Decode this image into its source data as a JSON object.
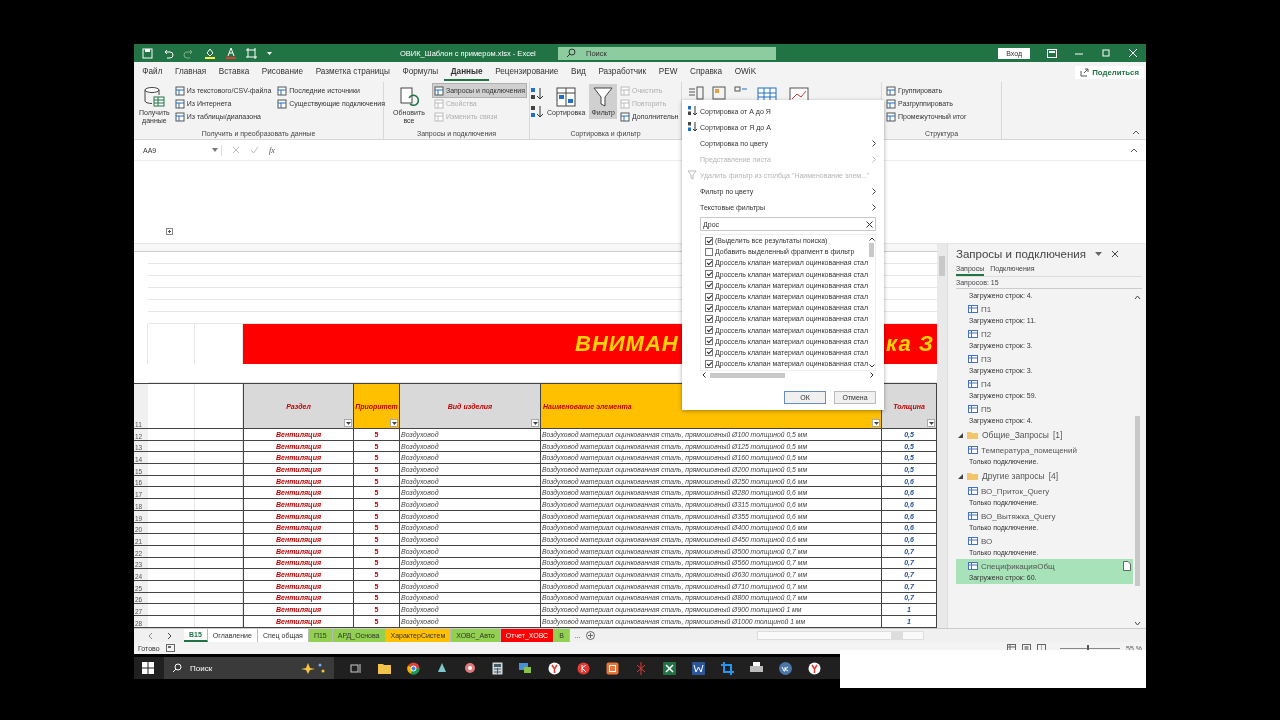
{
  "window": {
    "title": "ОВИК_Шаблон с примером.xlsx  -  Excel",
    "search_placeholder": "Поиск",
    "sign_in": "Вход"
  },
  "menu_tabs": [
    {
      "label": "Файл",
      "selected": false
    },
    {
      "label": "Главная",
      "selected": false
    },
    {
      "label": "Вставка",
      "selected": false
    },
    {
      "label": "Рисование",
      "selected": false
    },
    {
      "label": "Разметка страницы",
      "selected": false
    },
    {
      "label": "Формулы",
      "selected": false
    },
    {
      "label": "Данные",
      "selected": true
    },
    {
      "label": "Рецензирование",
      "selected": false
    },
    {
      "label": "Вид",
      "selected": false
    },
    {
      "label": "Разработчик",
      "selected": false
    },
    {
      "label": "PEW",
      "selected": false
    },
    {
      "label": "Справка",
      "selected": false
    },
    {
      "label": "OWiK",
      "selected": false
    }
  ],
  "share": "Поделиться",
  "ribbon_groups": [
    {
      "kind": "data",
      "title": "Получить и преобразовать данные",
      "large": [
        {
          "label": "Получить данные",
          "selected": false
        }
      ],
      "small": [
        {
          "label": "Из текстового/CSV-файла",
          "disabled": false,
          "selected": false
        },
        {
          "label": "Из Интернета",
          "disabled": false,
          "selected": false
        },
        {
          "label": "Из таблицы/диапазона",
          "disabled": false,
          "selected": false
        },
        {
          "label": "Последние источники",
          "disabled": false,
          "selected": false
        },
        {
          "label": "Существующие подключения",
          "disabled": false,
          "selected": false
        }
      ]
    },
    {
      "kind": "data",
      "title": "Запросы и подключения",
      "large": [
        {
          "label": "Обновить все",
          "selected": false
        }
      ],
      "small": [
        {
          "label": "Запросы и подключения",
          "disabled": false,
          "selected": true
        },
        {
          "label": "Свойства",
          "disabled": true,
          "selected": false
        },
        {
          "label": "Изменить связи",
          "disabled": true,
          "selected": false
        }
      ]
    },
    {
      "kind": "sort",
      "title": "Сортировка и фильтр",
      "large": [
        {
          "label": "Сортировка",
          "selected": false
        },
        {
          "label": "Фильтр",
          "selected": true
        }
      ],
      "small": [
        {
          "label": "Очистить",
          "disabled": true,
          "selected": false
        },
        {
          "label": "Повторить",
          "disabled": true,
          "selected": false
        },
        {
          "label": "Дополнительн",
          "disabled": false,
          "selected": false
        }
      ]
    },
    {
      "kind": "icons"
    },
    {
      "kind": "outline",
      "title": "Структура",
      "small": [
        {
          "label": "Группировать",
          "disabled": false,
          "selected": false
        },
        {
          "label": "Разгруппировать",
          "disabled": false,
          "selected": false
        },
        {
          "label": "Промежуточный итог",
          "disabled": false,
          "selected": false
        }
      ]
    }
  ],
  "formula_bar": {
    "name_box": "AA9",
    "function_label": "fx"
  },
  "sheet": {
    "banner": {
      "left_text": "ВНИМАН",
      "right_text": "ка З"
    },
    "header_row_number": "11",
    "columns": [
      {
        "label": "Раздел",
        "color": "#d9d9d9"
      },
      {
        "label": "Приоритет",
        "color": "#ffc000"
      },
      {
        "label": "Вид изделия",
        "color": "#d9d9d9"
      },
      {
        "label": "Наименование элемента",
        "color": "#ffc000"
      },
      {
        "label": "Толщина",
        "color": "#d9d9d9"
      }
    ],
    "rows": [
      {
        "number": "12",
        "section": "Вентиляция",
        "priority": "5",
        "type": "Воздуховод",
        "name": "Воздуховод материал оцинкованная сталь, прямошовный Ø100 толщиной 0,5 мм",
        "thickness": "0,5"
      },
      {
        "number": "13",
        "section": "Вентиляция",
        "priority": "5",
        "type": "Воздуховод",
        "name": "Воздуховод материал оцинкованная сталь, прямошовный Ø125 толщиной 0,5 мм",
        "thickness": "0,5"
      },
      {
        "number": "14",
        "section": "Вентиляция",
        "priority": "5",
        "type": "Воздуховод",
        "name": "Воздуховод материал оцинкованная сталь, прямошовный Ø160 толщиной 0,5 мм",
        "thickness": "0,5"
      },
      {
        "number": "15",
        "section": "Вентиляция",
        "priority": "5",
        "type": "Воздуховод",
        "name": "Воздуховод материал оцинкованная сталь, прямошовный Ø200 толщиной 0,5 мм",
        "thickness": "0,5"
      },
      {
        "number": "16",
        "section": "Вентиляция",
        "priority": "5",
        "type": "Воздуховод",
        "name": "Воздуховод материал оцинкованная сталь, прямошовный Ø250 толщиной 0,6 мм",
        "thickness": "0,6"
      },
      {
        "number": "17",
        "section": "Вентиляция",
        "priority": "5",
        "type": "Воздуховод",
        "name": "Воздуховод материал оцинкованная сталь, прямошовный Ø280 толщиной 0,6 мм",
        "thickness": "0,6"
      },
      {
        "number": "18",
        "section": "Вентиляция",
        "priority": "5",
        "type": "Воздуховод",
        "name": "Воздуховод материал оцинкованная сталь, прямошовный Ø315 толщиной 0,6 мм",
        "thickness": "0,6"
      },
      {
        "number": "19",
        "section": "Вентиляция",
        "priority": "5",
        "type": "Воздуховод",
        "name": "Воздуховод материал оцинкованная сталь, прямошовный Ø355 толщиной 0,6 мм",
        "thickness": "0,6"
      },
      {
        "number": "20",
        "section": "Вентиляция",
        "priority": "5",
        "type": "Воздуховод",
        "name": "Воздуховод материал оцинкованная сталь, прямошовный Ø400 толщиной 0,6 мм",
        "thickness": "0,6"
      },
      {
        "number": "21",
        "section": "Вентиляция",
        "priority": "5",
        "type": "Воздуховод",
        "name": "Воздуховод материал оцинкованная сталь, прямошовный Ø450 толщиной 0,6 мм",
        "thickness": "0,6"
      },
      {
        "number": "22",
        "section": "Вентиляция",
        "priority": "5",
        "type": "Воздуховод",
        "name": "Воздуховод материал оцинкованная сталь, прямошовный Ø500 толщиной 0,7 мм",
        "thickness": "0,7"
      },
      {
        "number": "23",
        "section": "Вентиляция",
        "priority": "5",
        "type": "Воздуховод",
        "name": "Воздуховод материал оцинкованная сталь, прямошовный Ø560 толщиной 0,7 мм",
        "thickness": "0,7"
      },
      {
        "number": "24",
        "section": "Вентиляция",
        "priority": "5",
        "type": "Воздуховод",
        "name": "Воздуховод материал оцинкованная сталь, прямошовный Ø630 толщиной 0,7 мм",
        "thickness": "0,7"
      },
      {
        "number": "25",
        "section": "Вентиляция",
        "priority": "5",
        "type": "Воздуховод",
        "name": "Воздуховод материал оцинкованная сталь, прямошовный Ø710 толщиной 0,7 мм",
        "thickness": "0,7"
      },
      {
        "number": "26",
        "section": "Вентиляция",
        "priority": "5",
        "type": "Воздуховод",
        "name": "Воздуховод материал оцинкованная сталь, прямошовный Ø800 толщиной 0,7 мм",
        "thickness": "0,7"
      },
      {
        "number": "27",
        "section": "Вентиляция",
        "priority": "5",
        "type": "Воздуховод",
        "name": "Воздуховод материал оцинкованная сталь, прямошовный Ø900 толщиной 1 мм",
        "thickness": "1"
      },
      {
        "number": "28",
        "section": "Вентиляция",
        "priority": "5",
        "type": "Воздуховод",
        "name": "Воздуховод материал оцинкованная сталь, прямошовный Ø1000 толщиной 1 мм",
        "thickness": "1"
      }
    ]
  },
  "filter_menu": {
    "items": [
      {
        "kind": "sort-asc",
        "label": "Сортировка от А до Я",
        "disabled": false
      },
      {
        "kind": "sort-desc",
        "label": "Сортировка от Я до А",
        "disabled": false
      },
      {
        "kind": "submenu",
        "label": "Сортировка по цвету",
        "disabled": false
      },
      {
        "kind": "submenu",
        "label": "Представление листа",
        "disabled": true
      },
      {
        "kind": "clear",
        "label": "Удалить фильтр из столбца \"Наименование элем...\"",
        "disabled": true
      },
      {
        "kind": "submenu",
        "label": "Фильтр по цвету",
        "disabled": false
      },
      {
        "kind": "submenu",
        "label": "Текстовые фильтры",
        "disabled": false
      }
    ],
    "search_value": "Дрос",
    "options": [
      {
        "label": "(Выделить все результаты поиска)",
        "checked": true
      },
      {
        "label": "Добавить выделенный фрагмент в фильтр",
        "checked": false
      },
      {
        "label": "Дроссель клапан материал оцинкованная стал",
        "checked": true
      },
      {
        "label": "Дроссель клапан материал оцинкованная стал",
        "checked": true
      },
      {
        "label": "Дроссель клапан материал оцинкованная стал",
        "checked": true
      },
      {
        "label": "Дроссель клапан материал оцинкованная стал",
        "checked": true
      },
      {
        "label": "Дроссель клапан материал оцинкованная стал",
        "checked": true
      },
      {
        "label": "Дроссель клапан материал оцинкованная стал",
        "checked": true
      },
      {
        "label": "Дроссель клапан материал оцинкованная стал",
        "checked": true
      },
      {
        "label": "Дроссель клапан материал оцинкованная стал",
        "checked": true
      },
      {
        "label": "Дроссель клапан материал оцинкованная стал",
        "checked": true
      },
      {
        "label": "Дроссель клапан материал оцинкованная стал",
        "checked": true
      }
    ],
    "ok": "ОК",
    "cancel": "Отмена"
  },
  "queries_pane": {
    "title": "Запросы и подключения",
    "tabs": [
      {
        "label": "Запросы",
        "selected": true
      },
      {
        "label": "Подключения",
        "selected": false
      }
    ],
    "count": "Запросов: 15",
    "items": [
      {
        "kind": "query",
        "status": "Загружено строк: 4.",
        "selected": false
      },
      {
        "kind": "query",
        "name": "П1",
        "status": "Загружено строк: 11.",
        "selected": false
      },
      {
        "kind": "query",
        "name": "П2",
        "status": "Загружено строк: 3.",
        "selected": false
      },
      {
        "kind": "query",
        "name": "П3",
        "status": "Загружено строк: 3.",
        "selected": false
      },
      {
        "kind": "query",
        "name": "П4",
        "status": "Загружено строк: 59.",
        "selected": false
      },
      {
        "kind": "query",
        "name": "П5",
        "status": "Загружено строк: 4.",
        "selected": false
      },
      {
        "kind": "group",
        "name": "Общие_Запросы",
        "count": "[1]",
        "expanded": true,
        "children": [
          {
            "kind": "query",
            "name": "Температура_помещений",
            "status": "Только подключение.",
            "selected": false
          }
        ]
      },
      {
        "kind": "group",
        "name": "Другие запросы",
        "count": "[4]",
        "expanded": true,
        "children": [
          {
            "kind": "query",
            "name": "ВО_Приток_Query",
            "status": "Только подключение.",
            "selected": false
          },
          {
            "kind": "query",
            "name": "ВО_Вытяжка_Query",
            "status": "Только подключение.",
            "selected": false
          },
          {
            "kind": "query",
            "name": "ВО",
            "status": "Только подключение.",
            "selected": false
          },
          {
            "kind": "query",
            "name": "СпецификацияОбщ",
            "status": "Загружено строк: 60.",
            "selected": true
          }
        ]
      }
    ]
  },
  "sheet_tabs": [
    {
      "label": "В15",
      "color": "#ffffff",
      "selected": true
    },
    {
      "label": "Оглавление",
      "color": "#ffffff",
      "selected": false
    },
    {
      "label": "Спец общая",
      "color": "#ffffff",
      "selected": false
    },
    {
      "label": "П15",
      "color": "#92d050",
      "selected": false
    },
    {
      "label": "АРД_Основа",
      "color": "#92d050",
      "selected": false
    },
    {
      "label": "ХарактерСистем",
      "color": "#ffc000",
      "selected": false
    },
    {
      "label": "ХОВС_Авто",
      "color": "#92d050",
      "selected": false
    },
    {
      "label": "Отчет_ХОВС",
      "color": "#ff0000",
      "selected": false
    },
    {
      "label": "В",
      "color": "#92d050",
      "selected": false
    }
  ],
  "sheet_tabs_more": "...",
  "status_bar": {
    "state": "Готово",
    "zoom": "55 %",
    "zoom_slider": {
      "level": 0.45
    }
  },
  "taskbar": {
    "search_placeholder": "Поиск"
  }
}
